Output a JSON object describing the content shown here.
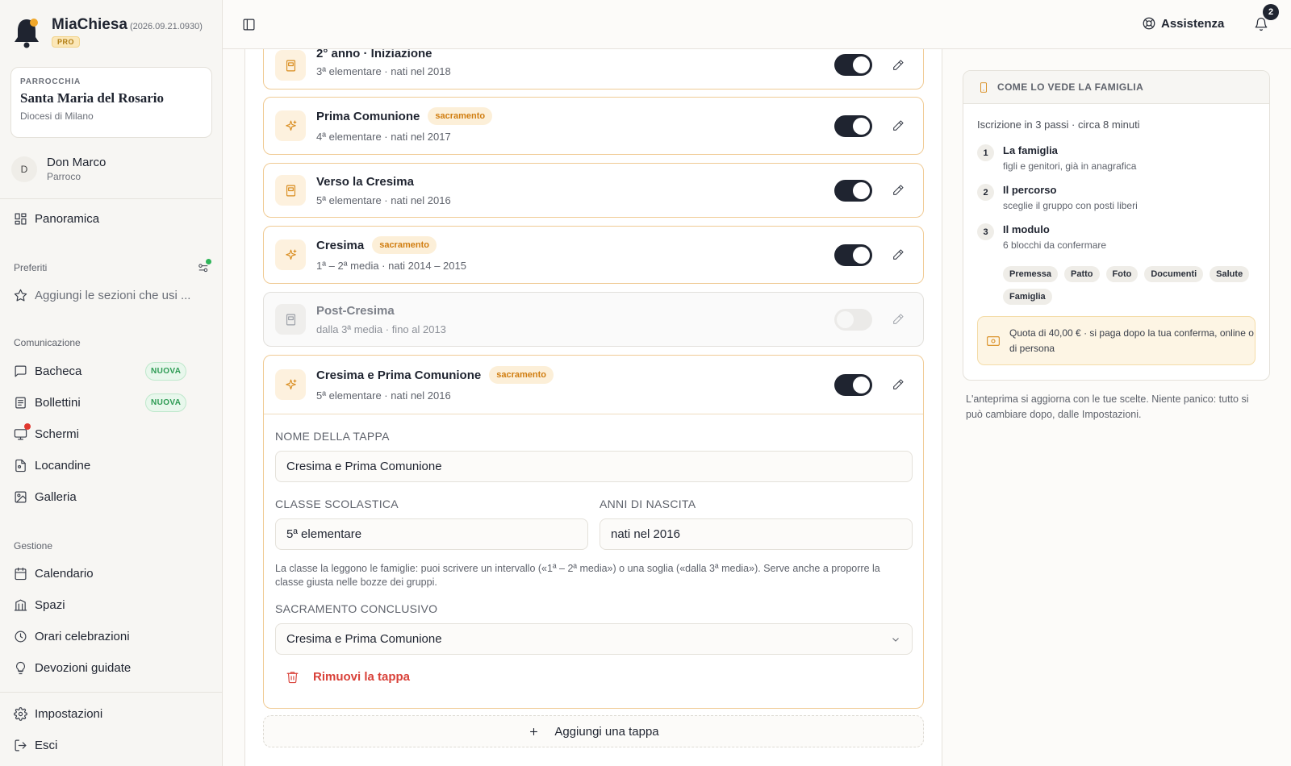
{
  "brand": {
    "name": "MiaChiesa",
    "version": "(2026.09.21.0930)",
    "badge": "PRO"
  },
  "parish": {
    "label": "PARROCCHIA",
    "name": "Santa Maria del Rosario",
    "diocese": "Diocesi di Milano"
  },
  "user": {
    "initial": "D",
    "name": "Don Marco",
    "role": "Parroco"
  },
  "nav": {
    "overview": "Panoramica",
    "favorites_label": "Preferiti",
    "favorites_add": "Aggiungi le sezioni che usi ...",
    "communication_label": "Comunicazione",
    "communication": [
      {
        "label": "Bacheca",
        "badge": "NUOVA",
        "icon": "message-icon"
      },
      {
        "label": "Bollettini",
        "badge": "NUOVA",
        "icon": "newspaper-icon"
      },
      {
        "label": "Schermi",
        "icon": "screen-icon"
      },
      {
        "label": "Locandine",
        "icon": "poster-icon"
      },
      {
        "label": "Galleria",
        "icon": "gallery-icon"
      }
    ],
    "management_label": "Gestione",
    "management": [
      {
        "label": "Calendario",
        "icon": "calendar-icon"
      },
      {
        "label": "Spazi",
        "icon": "building-icon"
      },
      {
        "label": "Orari celebrazioni",
        "icon": "clock-icon"
      },
      {
        "label": "Devozioni guidate",
        "icon": "lightbulb-icon"
      }
    ],
    "settings": "Impostazioni",
    "logout": "Esci"
  },
  "topbar": {
    "help": "Assistenza",
    "notifications": "2"
  },
  "stages": [
    {
      "title": "2° anno · Iniziazione",
      "subtitle": "3ª elementare · nati nel 2018",
      "badge": "",
      "enabled": true,
      "icon": "book-icon"
    },
    {
      "title": "Prima Comunione",
      "subtitle": "4ª elementare · nati nel 2017",
      "badge": "sacramento",
      "enabled": true,
      "icon": "sparkle-icon"
    },
    {
      "title": "Verso la Cresima",
      "subtitle": "5ª elementare · nati nel 2016",
      "badge": "",
      "enabled": true,
      "icon": "book-icon"
    },
    {
      "title": "Cresima",
      "subtitle": "1ª – 2ª media · nati 2014 – 2015",
      "badge": "sacramento",
      "enabled": true,
      "icon": "sparkle-icon"
    },
    {
      "title": "Post-Cresima",
      "subtitle": "dalla 3ª media · fino al 2013",
      "badge": "",
      "enabled": false,
      "icon": "book-icon"
    },
    {
      "title": "Cresima e Prima Comunione",
      "subtitle": "5ª elementare · nati nel 2016",
      "badge": "sacramento",
      "enabled": true,
      "icon": "sparkle-icon"
    }
  ],
  "editor": {
    "name_label": "NOME DELLA TAPPA",
    "name_value": "Cresima e Prima Comunione",
    "class_label": "CLASSE SCOLASTICA",
    "class_value": "5ª elementare",
    "years_label": "ANNI DI NASCITA",
    "years_value": "nati nel 2016",
    "help": "La classe la leggono le famiglie: puoi scrivere un intervallo («1ª – 2ª media») o una soglia («dalla 3ª media»). Serve anche a proporre la classe giusta nelle bozze dei gruppi.",
    "sacrament_label": "SACRAMENTO CONCLUSIVO",
    "sacrament_value": "Cresima e Prima Comunione",
    "remove": "Rimuovi la tappa"
  },
  "add_stage": "Aggiungi una tappa",
  "preview": {
    "header": "COME LO VEDE LA FAMIGLIA",
    "summary": "Iscrizione in 3 passi · circa 8 minuti",
    "steps": [
      {
        "num": "1",
        "title": "La famiglia",
        "sub": "figli e genitori, già in anagrafica"
      },
      {
        "num": "2",
        "title": "Il percorso",
        "sub": "sceglie il gruppo con posti liberi"
      },
      {
        "num": "3",
        "title": "Il modulo",
        "sub": "6 blocchi da confermare"
      }
    ],
    "chips": [
      "Premessa",
      "Patto",
      "Foto",
      "Documenti",
      "Salute",
      "Famiglia"
    ],
    "quota": "Quota di 40,00 € · si paga dopo la tua conferma, online o di persona",
    "note": "L'anteprima si aggiorna con le tue scelte. Niente panico: tutto si può cambiare dopo, dalle Impostazioni."
  },
  "colors": {
    "accent": "#d88a1a",
    "dark": "#1f2430",
    "danger": "#d9423a",
    "success": "#2e9b54"
  }
}
